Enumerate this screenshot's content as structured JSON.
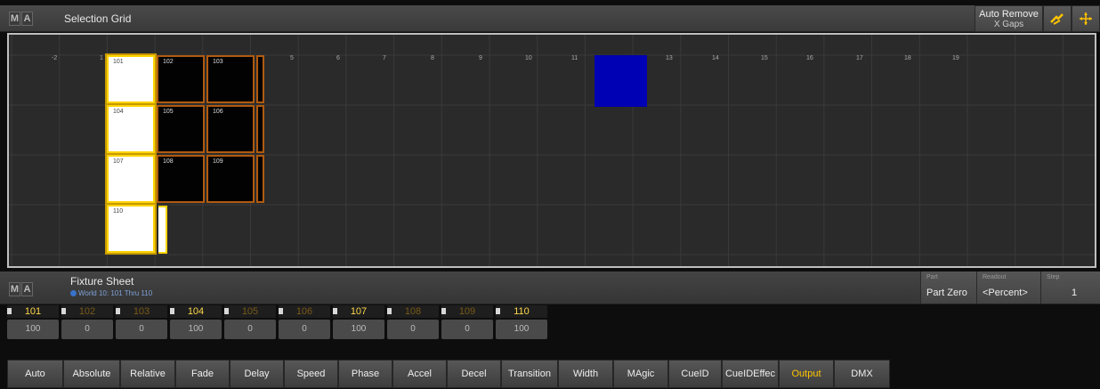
{
  "top_window": {
    "logo": [
      "M",
      "A"
    ],
    "title": "Selection Grid",
    "auto_remove_label": "Auto Remove",
    "x_gaps_label": "X Gaps",
    "icons": [
      "selection-hand-icon",
      "move-arrows-icon"
    ]
  },
  "grid": {
    "column_numbers": [
      "-2",
      "1",
      "2",
      "3",
      "4",
      "5",
      "6",
      "7",
      "8",
      "9",
      "10",
      "11",
      "12",
      "13",
      "14",
      "15",
      "16",
      "17",
      "18",
      "19"
    ],
    "cells": [
      {
        "id": "101",
        "style": "selected"
      },
      {
        "id": "102",
        "style": "dark"
      },
      {
        "id": "103",
        "style": "dark"
      },
      {
        "id": "104",
        "style": "selected"
      },
      {
        "id": "105",
        "style": "dark"
      },
      {
        "id": "106",
        "style": "dark"
      },
      {
        "id": "107",
        "style": "selected"
      },
      {
        "id": "108",
        "style": "dark"
      },
      {
        "id": "109",
        "style": "dark"
      },
      {
        "id": "110",
        "style": "selected"
      }
    ],
    "blue_cell_color": "#0000b4",
    "selection_color": "#ffd400",
    "dark_border_color": "#b05a10"
  },
  "bottom_window": {
    "logo": [
      "M",
      "A"
    ],
    "title": "Fixture Sheet",
    "subtitle": "World 10: 101 Thru 110",
    "part": {
      "label": "Part",
      "value": "Part Zero"
    },
    "readout": {
      "label": "Readout",
      "value": "<Percent>"
    },
    "step": {
      "label": "Step",
      "value": "1"
    }
  },
  "fixtures": [
    {
      "id": "101",
      "value": "100",
      "state": "selected"
    },
    {
      "id": "102",
      "value": "0",
      "state": "dim"
    },
    {
      "id": "103",
      "value": "0",
      "state": "dim"
    },
    {
      "id": "104",
      "value": "100",
      "state": "selected"
    },
    {
      "id": "105",
      "value": "0",
      "state": "dim"
    },
    {
      "id": "106",
      "value": "0",
      "state": "dim"
    },
    {
      "id": "107",
      "value": "100",
      "state": "selected"
    },
    {
      "id": "108",
      "value": "0",
      "state": "dim"
    },
    {
      "id": "109",
      "value": "0",
      "state": "dim"
    },
    {
      "id": "110",
      "value": "100",
      "state": "selected"
    }
  ],
  "buttons": [
    {
      "label": "Auto",
      "active": false
    },
    {
      "label": "Absolute",
      "active": false
    },
    {
      "label": "Relative",
      "active": false
    },
    {
      "label": "Fade",
      "active": false
    },
    {
      "label": "Delay",
      "active": false
    },
    {
      "label": "Speed",
      "active": false
    },
    {
      "label": "Phase",
      "active": false
    },
    {
      "label": "Accel",
      "active": false
    },
    {
      "label": "Decel",
      "active": false
    },
    {
      "label": "Transition",
      "active": false
    },
    {
      "label": "Width",
      "active": false
    },
    {
      "label": "MAgic",
      "active": false
    },
    {
      "label": "CueID",
      "active": false
    },
    {
      "label": "CueIDEffec",
      "active": false
    },
    {
      "label": "Output",
      "active": true
    },
    {
      "label": "DMX",
      "active": false
    }
  ]
}
